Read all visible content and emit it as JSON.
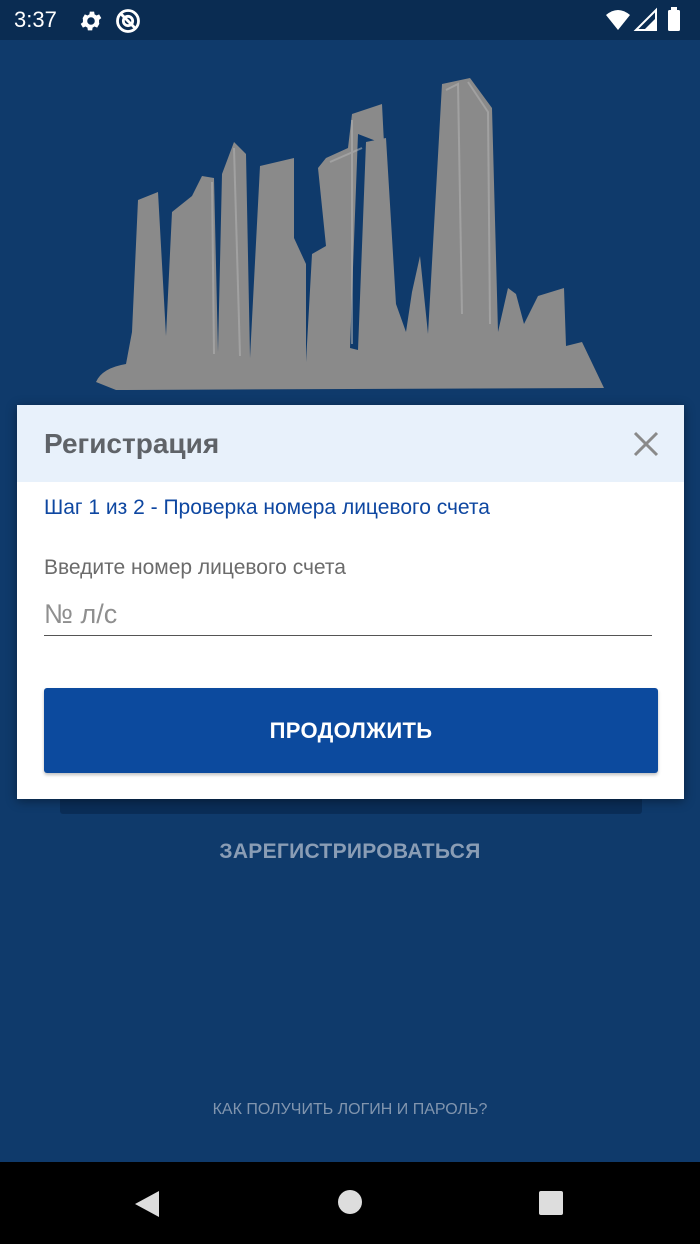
{
  "status_bar": {
    "time": "3:37",
    "icons": [
      "settings-gear-icon",
      "sync-disabled-icon",
      "wifi-icon",
      "cell-signal-icon",
      "battery-icon"
    ]
  },
  "background": {
    "register_link": "ЗАРЕГИСТРИРОВАТЬСЯ",
    "help_link": "КАК ПОЛУЧИТЬ ЛОГИН И ПАРОЛЬ?",
    "logo": "city-skyline-logo"
  },
  "dialog": {
    "title": "Регистрация",
    "step": "Шаг 1 из 2 - Проверка номера лицевого счета",
    "field_label": "Введите номер лицевого счета",
    "input_value": "",
    "input_placeholder": "№ л/с",
    "continue_label": "ПРОДОЛЖИТЬ",
    "close_icon": "close-icon"
  },
  "nav_bar": {
    "icons": [
      "back-icon",
      "home-icon",
      "recents-icon"
    ]
  },
  "colors": {
    "app_background": "#0f3a6b",
    "status_bar": "#0a2c52",
    "dialog_header": "#e8f1fb",
    "accent_button": "#0c4a9e",
    "step_text": "#0e47a1"
  }
}
